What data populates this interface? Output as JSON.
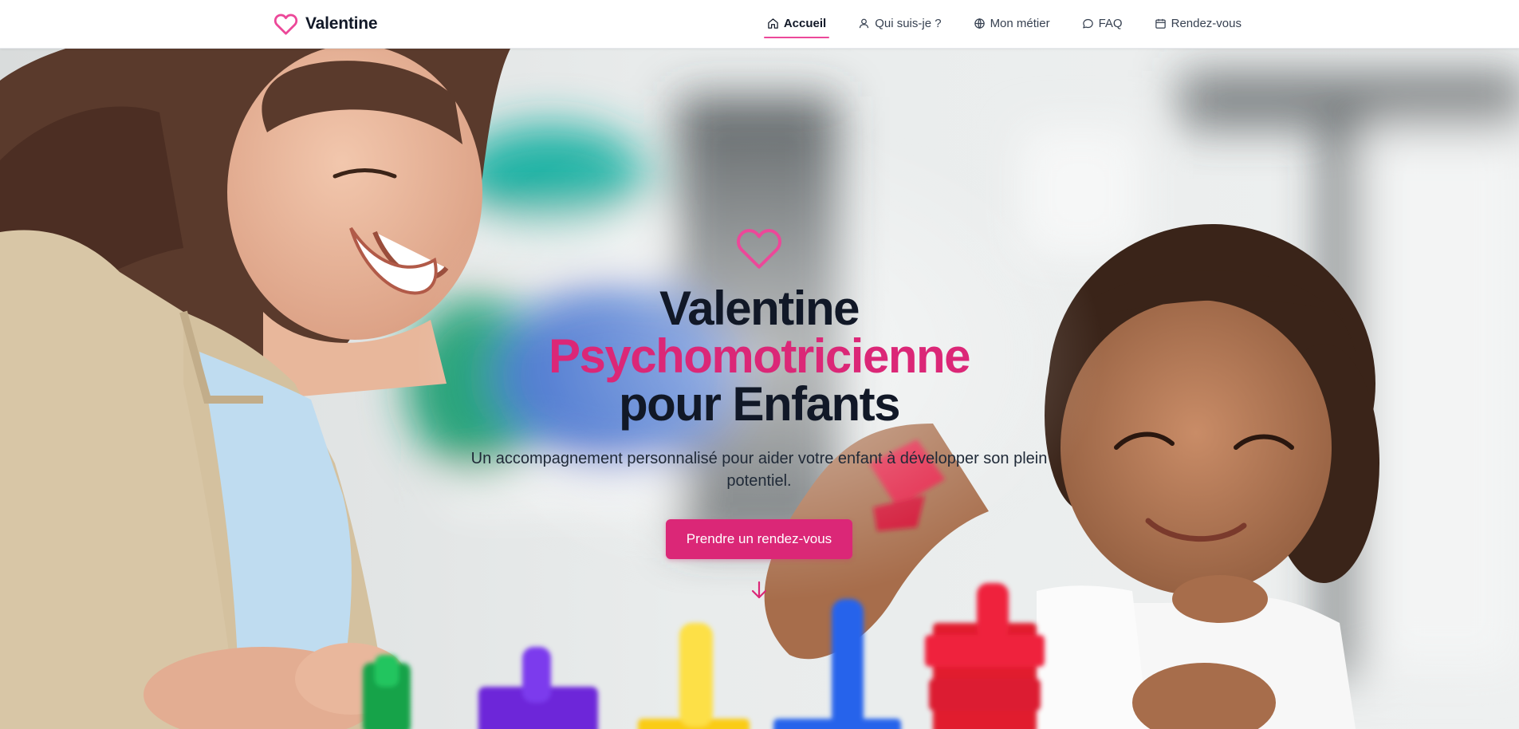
{
  "brand": {
    "name": "Valentine",
    "logo_icon": "heart-icon"
  },
  "nav": {
    "items": [
      {
        "label": "Accueil",
        "icon": "home-icon",
        "active": true
      },
      {
        "label": "Qui suis-je ?",
        "icon": "user-icon",
        "active": false
      },
      {
        "label": "Mon métier",
        "icon": "globe-icon",
        "active": false
      },
      {
        "label": "FAQ",
        "icon": "chat-bubble-icon",
        "active": false
      },
      {
        "label": "Rendez-vous",
        "icon": "calendar-icon",
        "active": false
      }
    ]
  },
  "hero": {
    "icon": "heart-icon",
    "title_line1": "Valentine",
    "title_line2": "Psychomotricienne",
    "title_line3": "pour Enfants",
    "subtitle": "Un accompagnement personnalisé pour aider votre enfant à développer son plein potentiel.",
    "cta_label": "Prendre un rendez-vous",
    "scroll_icon": "arrow-down-icon"
  },
  "colors": {
    "accent": "#db2777",
    "accent_light": "#ec4899",
    "text_dark": "#111827",
    "header_bg": "#ffffff"
  }
}
